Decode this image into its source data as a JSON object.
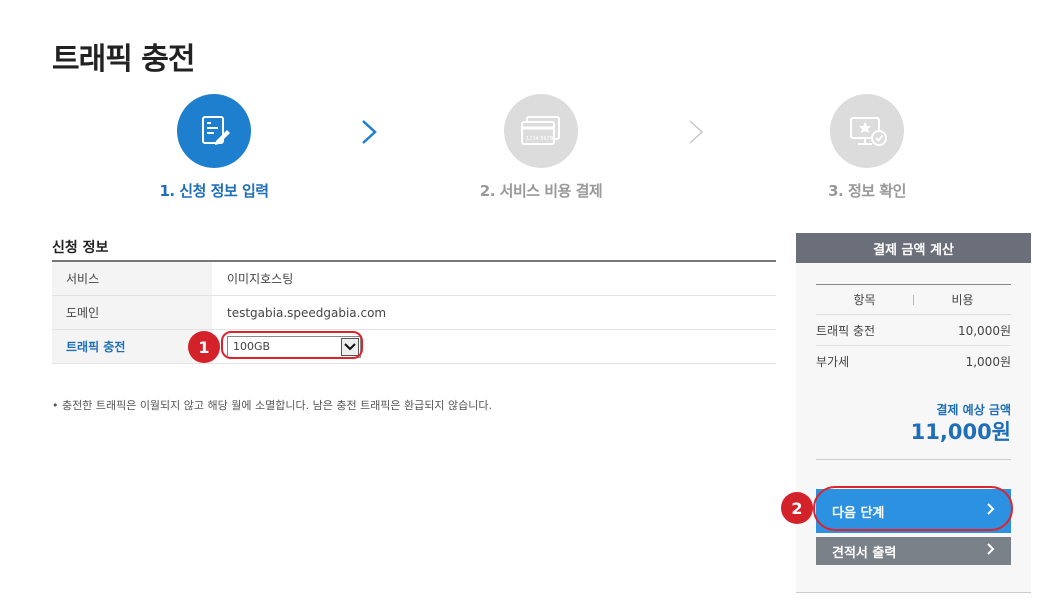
{
  "page": {
    "title": "트래픽 충전"
  },
  "steps": [
    {
      "label": "1. 신청 정보 입력",
      "icon": "document-edit-icon",
      "state": "active"
    },
    {
      "label": "2. 서비스 비용 결제",
      "icon": "credit-card-icon",
      "state": "inactive",
      "card_text": "1234 5678"
    },
    {
      "label": "3. 정보 확인",
      "icon": "monitor-check-icon",
      "state": "inactive"
    }
  ],
  "form": {
    "section_title": "신청 정보",
    "rows": [
      {
        "label": "서비스",
        "value": "이미지호스팅"
      },
      {
        "label": "도메인",
        "value": "testgabia.speedgabia.com"
      },
      {
        "label": "트래픽 충전",
        "select_value": "100GB"
      }
    ],
    "note": "• 충전한 트래픽은 이월되지 않고 해당 월에 소멸합니다. 남은 충전 트래픽은 환급되지 않습니다."
  },
  "callouts": {
    "one": "1",
    "two": "2"
  },
  "panel": {
    "title": "결제 금액 계산",
    "columns": {
      "item": "항목",
      "cost": "비용"
    },
    "rows": [
      {
        "item": "트래픽 충전",
        "cost": "10,000원"
      },
      {
        "item": "부가세",
        "cost": "1,000원"
      }
    ],
    "total_label": "결제 예상 금액",
    "total_amount": "11,000원",
    "next_button": "다음 단계",
    "quote_button": "견적서 출력"
  },
  "colors": {
    "accent": "#1f7fcf",
    "highlight": "#e0232b",
    "button": "#2b91e0",
    "button_gray": "#7b8189"
  }
}
